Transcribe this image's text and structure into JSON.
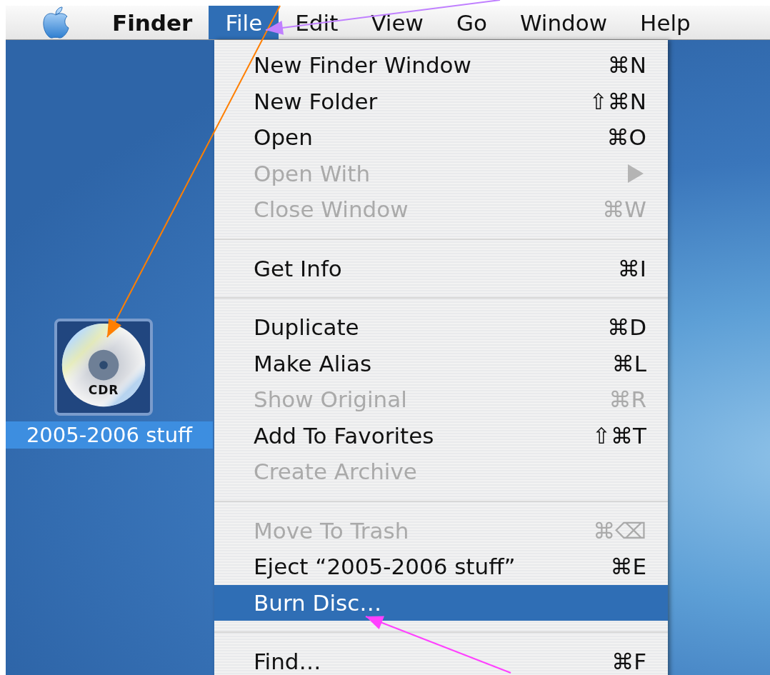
{
  "menu_bar": {
    "items": [
      {
        "label": "Finder",
        "kind": "app",
        "selected": false
      },
      {
        "label": "File",
        "kind": "menu",
        "selected": true
      },
      {
        "label": "Edit",
        "kind": "menu",
        "selected": false
      },
      {
        "label": "View",
        "kind": "menu",
        "selected": false
      },
      {
        "label": "Go",
        "kind": "menu",
        "selected": false
      },
      {
        "label": "Window",
        "kind": "menu",
        "selected": false
      },
      {
        "label": "Help",
        "kind": "menu",
        "selected": false
      }
    ]
  },
  "file_menu": {
    "items": [
      {
        "kind": "item",
        "label": "New Finder Window",
        "shortcut": "⌘N",
        "disabled": false,
        "selected": false
      },
      {
        "kind": "item",
        "label": "New Folder",
        "shortcut": "⇧⌘N",
        "disabled": false,
        "selected": false
      },
      {
        "kind": "item",
        "label": "Open",
        "shortcut": "⌘O",
        "disabled": false,
        "selected": false
      },
      {
        "kind": "submenu",
        "label": "Open With",
        "disabled": true,
        "selected": false
      },
      {
        "kind": "item",
        "label": "Close Window",
        "shortcut": "⌘W",
        "disabled": true,
        "selected": false
      },
      {
        "kind": "separator"
      },
      {
        "kind": "item",
        "label": "Get Info",
        "shortcut": "⌘I",
        "disabled": false,
        "selected": false
      },
      {
        "kind": "separator"
      },
      {
        "kind": "item",
        "label": "Duplicate",
        "shortcut": "⌘D",
        "disabled": false,
        "selected": false
      },
      {
        "kind": "item",
        "label": "Make Alias",
        "shortcut": "⌘L",
        "disabled": false,
        "selected": false
      },
      {
        "kind": "item",
        "label": "Show Original",
        "shortcut": "⌘R",
        "disabled": true,
        "selected": false
      },
      {
        "kind": "item",
        "label": "Add To Favorites",
        "shortcut": "⇧⌘T",
        "disabled": false,
        "selected": false
      },
      {
        "kind": "item",
        "label": "Create Archive",
        "disabled": true,
        "selected": false
      },
      {
        "kind": "separator"
      },
      {
        "kind": "item",
        "label": "Move To Trash",
        "shortcut": "⌘⌫",
        "disabled": true,
        "selected": false
      },
      {
        "kind": "item",
        "label": "Eject “2005-2006 stuff”",
        "shortcut": "⌘E",
        "disabled": false,
        "selected": false
      },
      {
        "kind": "item",
        "label": "Burn Disc…",
        "disabled": false,
        "selected": true
      },
      {
        "kind": "separator"
      },
      {
        "kind": "item",
        "label": "Find…",
        "shortcut": "⌘F",
        "disabled": false,
        "selected": false
      }
    ]
  },
  "desktop_icon": {
    "label": "2005-2006 stuff",
    "disc_label": "CDR",
    "selected": true
  },
  "annotations": [
    {
      "color": "#ff7f00"
    },
    {
      "color": "#c080ff"
    },
    {
      "color": "#ff40ff"
    }
  ]
}
